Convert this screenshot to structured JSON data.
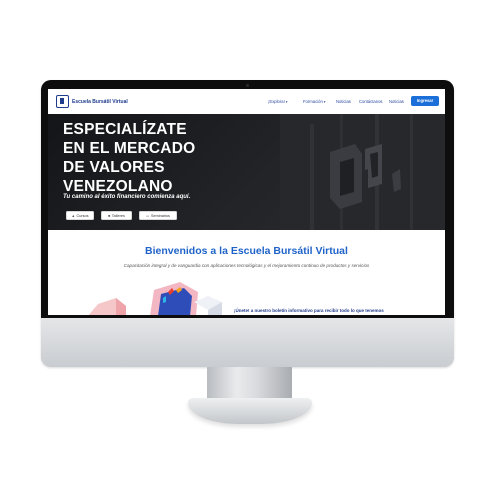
{
  "nav": {
    "brand": "Escuela Bursátil Virtual",
    "links": [
      {
        "label": "¡Explora!",
        "caret": "▾"
      },
      {
        "label": "Formación",
        "caret": "▾"
      },
      {
        "label": "Noticias",
        "caret": ""
      },
      {
        "label": "Contáctanos",
        "caret": ""
      },
      {
        "label": "Noticias",
        "caret": ""
      }
    ],
    "cta": "Ingresar"
  },
  "hero": {
    "title_lines": [
      "ESPECIALÍZATE",
      "EN EL MERCADO",
      "DE VALORES",
      "VENEZOLANO"
    ],
    "subtitle": "Tu camino al éxito financiero comienza aquí.",
    "buttons": [
      {
        "label": "Cursos",
        "icon": "graduation-cap-icon"
      },
      {
        "label": "Talleres",
        "icon": "building-icon"
      },
      {
        "label": "Seminarios",
        "icon": "presentation-icon"
      }
    ]
  },
  "welcome": {
    "title": "Bienvenidos a la Escuela Bursátil Virtual",
    "subtitle": "Capacitación integral y de vanguardia con aplicaciones tecnológicas y el mejoramiento continuo de productos y servicios",
    "newsletter": "¡Únete! a nuestro boletín informativo para recibir todo lo que tenemos"
  },
  "colors": {
    "brand_blue": "#1f3b8c",
    "accent_blue": "#1b6fd8",
    "title_blue": "#1f63c9",
    "hero_dark": "#1c1d20"
  }
}
